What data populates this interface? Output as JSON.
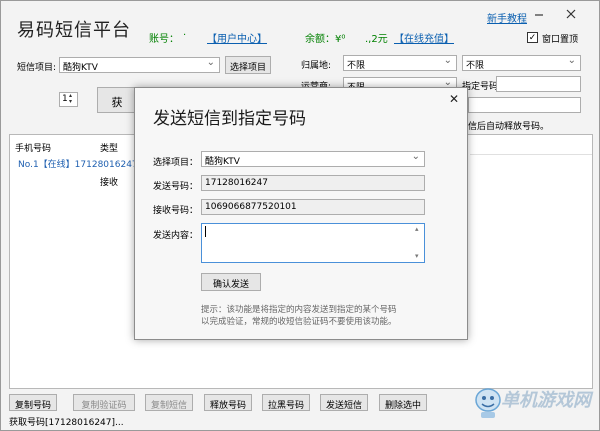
{
  "app": {
    "title": "易码短信平台",
    "account_label": "账号：",
    "account_value": "·",
    "user_center_link": "【用户中心】",
    "balance_label": "余额：¥⁰",
    "balance_value": ".,2元",
    "recharge_link": "【在线充值】",
    "tutorial_link": "新手教程",
    "minimize_icon": "minimize-icon",
    "close_icon": "close-icon",
    "topmost_label": "窗口置顶"
  },
  "filters": {
    "project_label": "短信项目:",
    "project_value": "酷狗KTV",
    "select_project_button": "选择项目",
    "home_label": "归属地:",
    "home_value": "不限",
    "home_value2": "不限",
    "carrier_label": "运营商:",
    "carrier_value": "不限",
    "assign_number_label": "指定号码:",
    "quantity_value": "1",
    "get_button_partial": "获",
    "auto_release_text": "信后自动释放号码。"
  },
  "table": {
    "col_phone": "手机号码",
    "col_type": "类型",
    "row_label": "No.1【在线】17128016247",
    "row_type": "接收"
  },
  "dialog": {
    "title": "发送短信到指定号码",
    "project_label": "选择项目：",
    "project_value": "酷狗KTV",
    "send_number_label": "发送号码：",
    "send_number_value": "17128016247",
    "recv_number_label": "接收号码：",
    "recv_number_value": "1069066877520101",
    "content_label": "发送内容：",
    "confirm_button": "确认发送",
    "hint_line1": "提示：该功能是将指定的内容发送到指定的某个号码",
    "hint_line2": "以完成验证，常规的收短信验证码不要使用该功能。"
  },
  "toolbar": {
    "copy_number": "复制号码",
    "copy_code": "复制验证码",
    "copy_sms": "复制短信",
    "release_number": "释放号码",
    "blacklist_number": "拉黑号码",
    "send_sms": "发送短信",
    "delete_selected": "删除选中"
  },
  "status": {
    "text": "获取号码[17128016247]..."
  },
  "watermark": {
    "text": "单机游戏网",
    "icon": "mascot-icon"
  }
}
